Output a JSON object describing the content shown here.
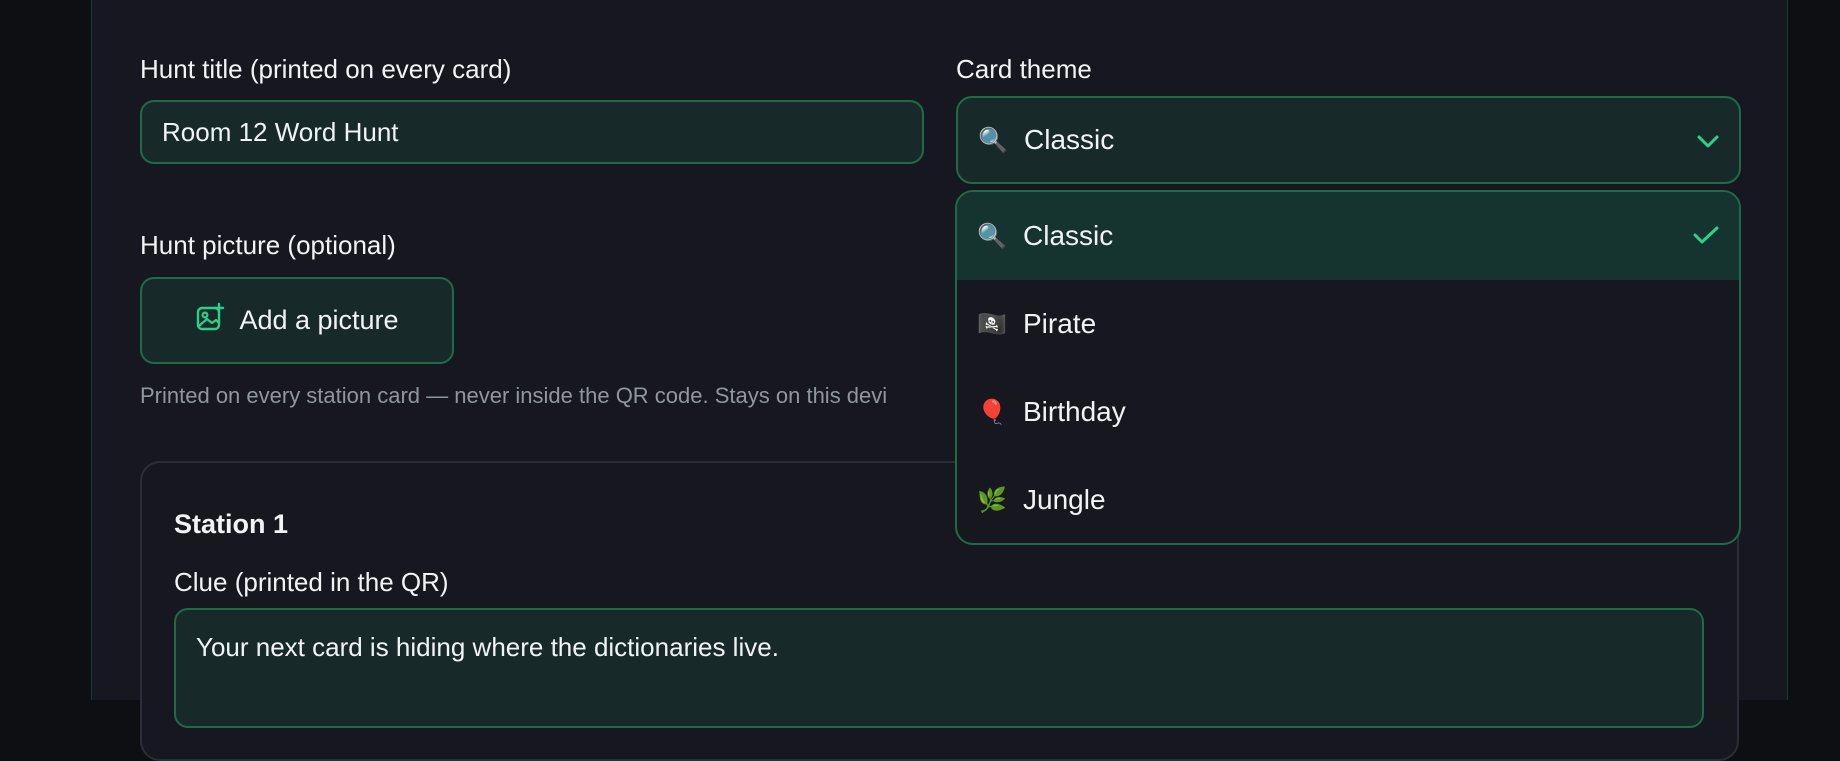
{
  "form": {
    "title_label": "Hunt title (printed on every card)",
    "title_value": "Room 12 Word Hunt",
    "theme_label": "Card theme",
    "theme_selected": {
      "emoji": "🔍",
      "label": "Classic"
    },
    "picture_label": "Hunt picture (optional)",
    "add_picture_label": "Add a picture",
    "picture_hint": "Printed on every station card — never inside the QR code. Stays on this devi"
  },
  "station": {
    "title": "Station 1",
    "clue_label": "Clue (printed in the QR)",
    "clue_value": "Your next card is hiding where the dictionaries live."
  },
  "theme_options": [
    {
      "emoji": "🔍",
      "label": "Classic",
      "selected": true
    },
    {
      "emoji": "🏴‍☠️",
      "label": "Pirate",
      "selected": false
    },
    {
      "emoji": "🎈",
      "label": "Birthday",
      "selected": false
    },
    {
      "emoji": "🌿",
      "label": "Jungle",
      "selected": false
    }
  ],
  "colors": {
    "accent": "#2bd18a",
    "field_bg": "#172a29",
    "field_border": "#1e6b4a",
    "panel_bg": "#17181f",
    "selected_bg": "#15342f"
  },
  "icons": {
    "add_picture": "image-plus-icon",
    "select_chevron": "chevron-down-icon",
    "selected_check": "check-icon"
  }
}
